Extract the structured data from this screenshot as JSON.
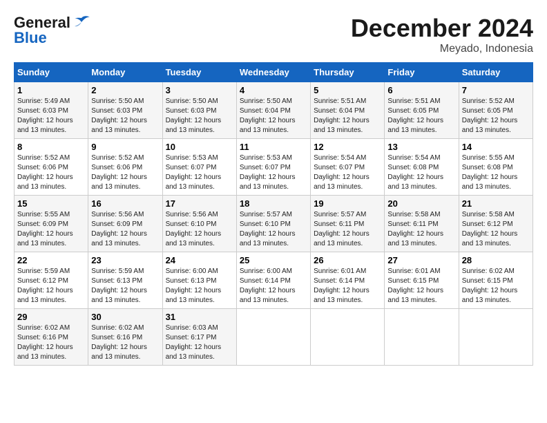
{
  "header": {
    "logo_line1": "General",
    "logo_line2": "Blue",
    "main_title": "December 2024",
    "subtitle": "Meyado, Indonesia"
  },
  "days_of_week": [
    "Sunday",
    "Monday",
    "Tuesday",
    "Wednesday",
    "Thursday",
    "Friday",
    "Saturday"
  ],
  "weeks": [
    [
      {
        "day": "1",
        "sunrise": "5:49 AM",
        "sunset": "6:03 PM",
        "daylight": "12 hours and 13 minutes."
      },
      {
        "day": "2",
        "sunrise": "5:50 AM",
        "sunset": "6:03 PM",
        "daylight": "12 hours and 13 minutes."
      },
      {
        "day": "3",
        "sunrise": "5:50 AM",
        "sunset": "6:03 PM",
        "daylight": "12 hours and 13 minutes."
      },
      {
        "day": "4",
        "sunrise": "5:50 AM",
        "sunset": "6:04 PM",
        "daylight": "12 hours and 13 minutes."
      },
      {
        "day": "5",
        "sunrise": "5:51 AM",
        "sunset": "6:04 PM",
        "daylight": "12 hours and 13 minutes."
      },
      {
        "day": "6",
        "sunrise": "5:51 AM",
        "sunset": "6:05 PM",
        "daylight": "12 hours and 13 minutes."
      },
      {
        "day": "7",
        "sunrise": "5:52 AM",
        "sunset": "6:05 PM",
        "daylight": "12 hours and 13 minutes."
      }
    ],
    [
      {
        "day": "8",
        "sunrise": "5:52 AM",
        "sunset": "6:06 PM",
        "daylight": "12 hours and 13 minutes."
      },
      {
        "day": "9",
        "sunrise": "5:52 AM",
        "sunset": "6:06 PM",
        "daylight": "12 hours and 13 minutes."
      },
      {
        "day": "10",
        "sunrise": "5:53 AM",
        "sunset": "6:07 PM",
        "daylight": "12 hours and 13 minutes."
      },
      {
        "day": "11",
        "sunrise": "5:53 AM",
        "sunset": "6:07 PM",
        "daylight": "12 hours and 13 minutes."
      },
      {
        "day": "12",
        "sunrise": "5:54 AM",
        "sunset": "6:07 PM",
        "daylight": "12 hours and 13 minutes."
      },
      {
        "day": "13",
        "sunrise": "5:54 AM",
        "sunset": "6:08 PM",
        "daylight": "12 hours and 13 minutes."
      },
      {
        "day": "14",
        "sunrise": "5:55 AM",
        "sunset": "6:08 PM",
        "daylight": "12 hours and 13 minutes."
      }
    ],
    [
      {
        "day": "15",
        "sunrise": "5:55 AM",
        "sunset": "6:09 PM",
        "daylight": "12 hours and 13 minutes."
      },
      {
        "day": "16",
        "sunrise": "5:56 AM",
        "sunset": "6:09 PM",
        "daylight": "12 hours and 13 minutes."
      },
      {
        "day": "17",
        "sunrise": "5:56 AM",
        "sunset": "6:10 PM",
        "daylight": "12 hours and 13 minutes."
      },
      {
        "day": "18",
        "sunrise": "5:57 AM",
        "sunset": "6:10 PM",
        "daylight": "12 hours and 13 minutes."
      },
      {
        "day": "19",
        "sunrise": "5:57 AM",
        "sunset": "6:11 PM",
        "daylight": "12 hours and 13 minutes."
      },
      {
        "day": "20",
        "sunrise": "5:58 AM",
        "sunset": "6:11 PM",
        "daylight": "12 hours and 13 minutes."
      },
      {
        "day": "21",
        "sunrise": "5:58 AM",
        "sunset": "6:12 PM",
        "daylight": "12 hours and 13 minutes."
      }
    ],
    [
      {
        "day": "22",
        "sunrise": "5:59 AM",
        "sunset": "6:12 PM",
        "daylight": "12 hours and 13 minutes."
      },
      {
        "day": "23",
        "sunrise": "5:59 AM",
        "sunset": "6:13 PM",
        "daylight": "12 hours and 13 minutes."
      },
      {
        "day": "24",
        "sunrise": "6:00 AM",
        "sunset": "6:13 PM",
        "daylight": "12 hours and 13 minutes."
      },
      {
        "day": "25",
        "sunrise": "6:00 AM",
        "sunset": "6:14 PM",
        "daylight": "12 hours and 13 minutes."
      },
      {
        "day": "26",
        "sunrise": "6:01 AM",
        "sunset": "6:14 PM",
        "daylight": "12 hours and 13 minutes."
      },
      {
        "day": "27",
        "sunrise": "6:01 AM",
        "sunset": "6:15 PM",
        "daylight": "12 hours and 13 minutes."
      },
      {
        "day": "28",
        "sunrise": "6:02 AM",
        "sunset": "6:15 PM",
        "daylight": "12 hours and 13 minutes."
      }
    ],
    [
      {
        "day": "29",
        "sunrise": "6:02 AM",
        "sunset": "6:16 PM",
        "daylight": "12 hours and 13 minutes."
      },
      {
        "day": "30",
        "sunrise": "6:02 AM",
        "sunset": "6:16 PM",
        "daylight": "12 hours and 13 minutes."
      },
      {
        "day": "31",
        "sunrise": "6:03 AM",
        "sunset": "6:17 PM",
        "daylight": "12 hours and 13 minutes."
      },
      null,
      null,
      null,
      null
    ]
  ],
  "labels": {
    "sunrise": "Sunrise:",
    "sunset": "Sunset:",
    "daylight": "Daylight:"
  }
}
